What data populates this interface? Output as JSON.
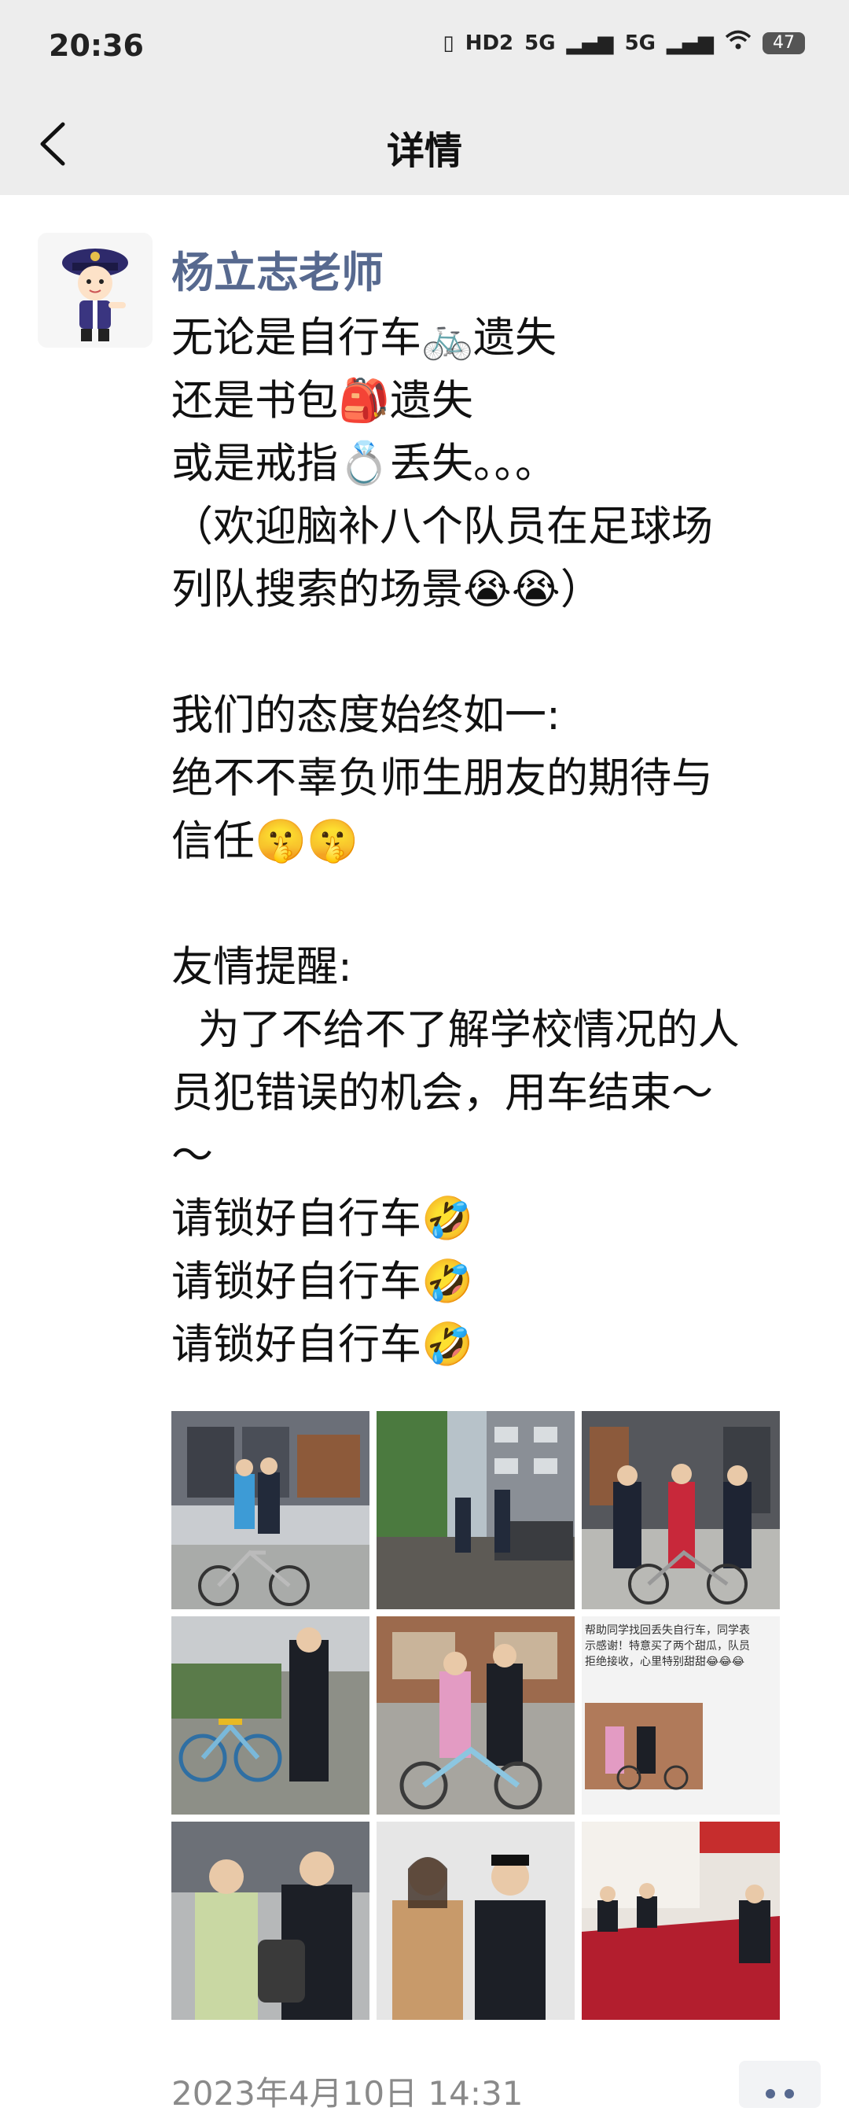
{
  "status_bar": {
    "time": "20:36",
    "icons": [
      "vibrate-icon",
      "hd-icon",
      "signal-5g-icon",
      "signal-5g-icon",
      "wifi-icon"
    ],
    "hd_label": "HD2",
    "signal1_label": "5G",
    "signal2_label": "5G",
    "battery": "47"
  },
  "nav": {
    "title": "详情",
    "back_icon": "chevron-left-icon"
  },
  "post": {
    "author": "杨立志老师",
    "lines": [
      "无论是自行车🚲遗失",
      "还是书包🎒遗失",
      "或是戒指💍丢失。。。",
      "（欢迎脑补八个队员在足球场",
      "列队搜索的场景😭😭）",
      "",
      "我们的态度始终如一:",
      "绝不不辜负师生朋友的期待与",
      "信任🤫🤫",
      "",
      "友情提醒:",
      "  为了不给不了解学校情况的人",
      "员犯错误的机会，用车结束～",
      "～",
      "请锁好自行车🤣",
      "请锁好自行车🤣",
      "请锁好自行车🤣"
    ],
    "timestamp": "2023年4月10日 14:31"
  },
  "photos": [
    {
      "name": "photo-student-bike-campus"
    },
    {
      "name": "photo-campus-walkway"
    },
    {
      "name": "photo-guards-with-student-bike"
    },
    {
      "name": "photo-shared-bikes-guard"
    },
    {
      "name": "photo-student-guard-blue-bike"
    },
    {
      "name": "photo-chat-screenshot"
    },
    {
      "name": "photo-student-backpack-handover"
    },
    {
      "name": "photo-student-guard-portrait"
    },
    {
      "name": "photo-meeting-room"
    }
  ],
  "photo6_text": {
    "line1": "帮助同学找回丢失自行车，同学表",
    "line2": "示感谢！特意买了两个甜瓜，队员",
    "line3": "拒绝接收，心里特别甜甜😂😂😂"
  },
  "colors": {
    "author": "#57698f",
    "nav_bg": "#ededed",
    "timestamp": "#8a8a8a"
  }
}
